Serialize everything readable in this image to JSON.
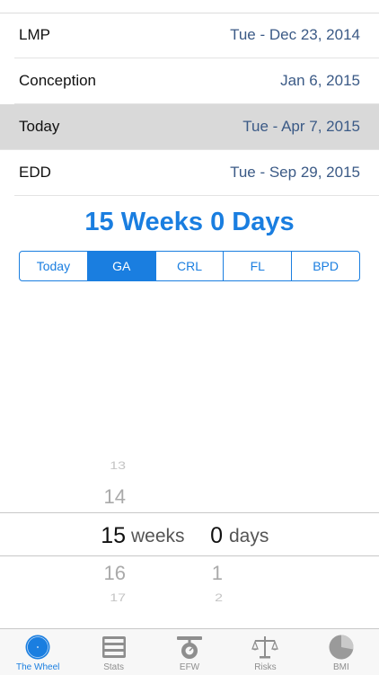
{
  "dates": [
    {
      "label": "LMP",
      "value": "Tue - Dec 23, 2014"
    },
    {
      "label": "Conception",
      "value": "Jan 6, 2015"
    },
    {
      "label": "Today",
      "value": "Tue - Apr 7, 2015"
    },
    {
      "label": "EDD",
      "value": "Tue - Sep 29, 2015"
    }
  ],
  "ga_headline": "15 Weeks 0 Days",
  "segments": [
    "Today",
    "GA",
    "CRL",
    "FL",
    "BPD"
  ],
  "selected_segment": "GA",
  "picker": {
    "weeks": {
      "above2": "13",
      "above1": "14",
      "selected": "15",
      "below1": "16",
      "below2": "17",
      "unit": "weeks"
    },
    "days": {
      "selected": "0",
      "below1": "1",
      "below2": "2",
      "unit": "days"
    }
  },
  "tabs": [
    {
      "label": "The Wheel",
      "icon": "wheel-icon"
    },
    {
      "label": "Stats",
      "icon": "stats-icon"
    },
    {
      "label": "EFW",
      "icon": "scale-icon"
    },
    {
      "label": "Risks",
      "icon": "balance-icon"
    },
    {
      "label": "BMI",
      "icon": "pie-icon"
    }
  ],
  "active_tab": "The Wheel",
  "colors": {
    "accent": "#1a7ee0",
    "value_text": "#3b5a86",
    "selected_row": "#d9d9d9"
  }
}
